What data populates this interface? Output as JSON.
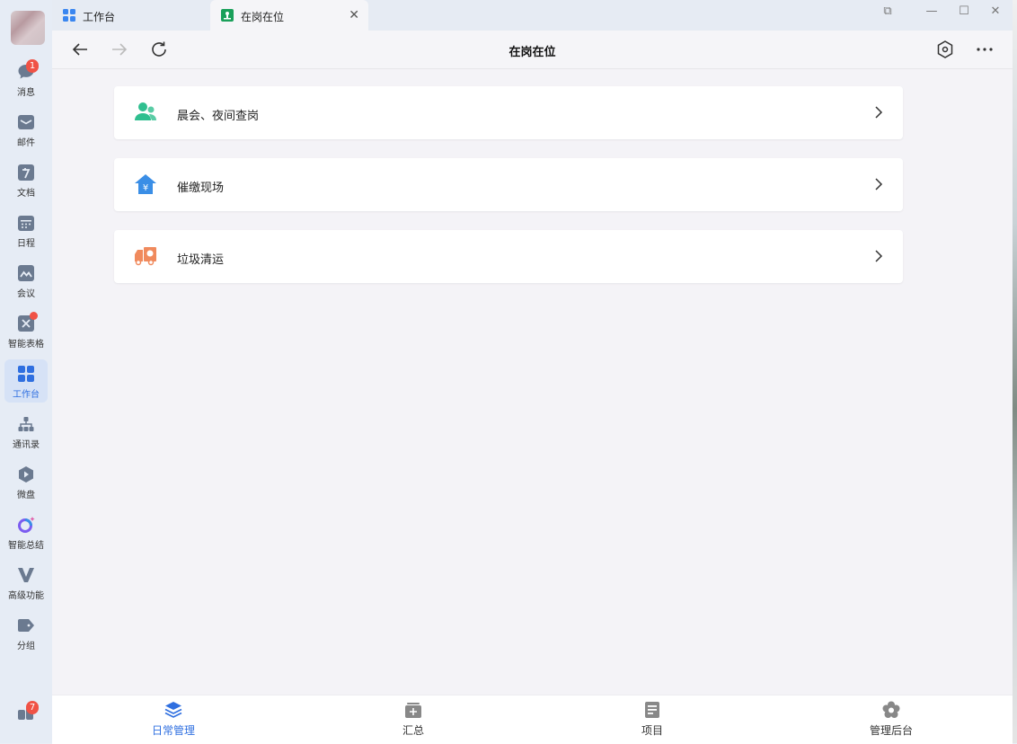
{
  "sidebar": {
    "items": [
      {
        "label": "消息",
        "icon": "chat-bubble-icon",
        "badge": "1"
      },
      {
        "label": "邮件",
        "icon": "mail-icon"
      },
      {
        "label": "文档",
        "icon": "document-icon"
      },
      {
        "label": "日程",
        "icon": "calendar-icon"
      },
      {
        "label": "会议",
        "icon": "meeting-icon"
      },
      {
        "label": "智能表格",
        "icon": "smart-table-icon",
        "dot": true
      },
      {
        "label": "工作台",
        "icon": "workbench-grid-icon",
        "active": true
      },
      {
        "label": "通讯录",
        "icon": "contacts-tree-icon"
      },
      {
        "label": "微盘",
        "icon": "drive-icon"
      },
      {
        "label": "智能总结",
        "icon": "ai-summary-icon"
      },
      {
        "label": "高级功能",
        "icon": "advanced-v-icon"
      },
      {
        "label": "分组",
        "icon": "tag-icon"
      }
    ],
    "bottom_badge": "7"
  },
  "tabs": [
    {
      "label": "工作台",
      "icon": "workbench-grid-icon"
    },
    {
      "label": "在岗在位",
      "icon": "app-green-icon",
      "active": true
    }
  ],
  "toolbar": {
    "title": "在岗在位"
  },
  "cards": [
    {
      "label": "晨会、夜间查岗",
      "icon": "users-icon",
      "color": "#2fbf8f"
    },
    {
      "label": "催缴现场",
      "icon": "yuan-house-icon",
      "color": "#3a8ee6"
    },
    {
      "label": "垃圾清运",
      "icon": "truck-icon",
      "color": "#f08a5d"
    }
  ],
  "bottom_nav": [
    {
      "label": "日常管理",
      "icon": "layers-icon",
      "active": true
    },
    {
      "label": "汇总",
      "icon": "summary-box-icon"
    },
    {
      "label": "项目",
      "icon": "project-list-icon"
    },
    {
      "label": "管理后台",
      "icon": "settings-flower-icon"
    }
  ],
  "colors": {
    "accent": "#2f6fe0",
    "badge": "#f05245"
  }
}
